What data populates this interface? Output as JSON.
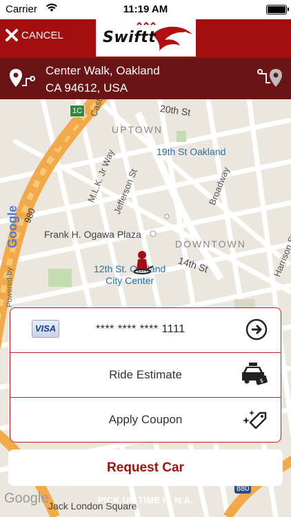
{
  "status_bar": {
    "carrier": "Carrier",
    "time": "11:19 AM"
  },
  "header": {
    "cancel_label": "CANCEL",
    "logo_text": "Swiftt"
  },
  "pickup_address": {
    "line1": "Center Walk, Oakland",
    "line2": "CA 94612, USA"
  },
  "map": {
    "labels": {
      "route_1c": "1C",
      "castro": "Castro",
      "street_20th": "20th St",
      "uptown": "UPTOWN",
      "station_19th": "19th St Oakland",
      "mlk": "M.L.K. Jr Way",
      "jefferson": "Jefferson St",
      "broadway": "Broadway",
      "route_980": "980",
      "ogawa": "Frank H. Ogawa Plaza",
      "downtown": "DOWNTOWN",
      "street_14th": "14th St",
      "harrison": "Harrison St",
      "station_12th_line1": "12th St. Oakland",
      "station_12th_line2": "City Center",
      "google": "Google",
      "powered_by": "Powered by",
      "jack_london": "Jack London Square",
      "route_880": "880"
    }
  },
  "payment": {
    "card_brand": "VISA",
    "card_number": "**** **** **** 1111",
    "ride_estimate_label": "Ride Estimate",
    "coupon_label": "Apply Coupon"
  },
  "actions": {
    "request_label": "Request Car"
  },
  "footer": {
    "pickup_time": "PICK UP TIME IS N.A."
  },
  "colors": {
    "brand_red": "#a30f0f",
    "address_bar": "#6a1515"
  }
}
